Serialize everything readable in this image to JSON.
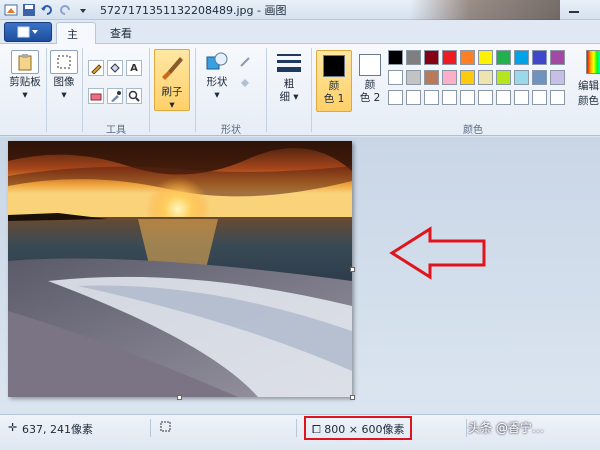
{
  "window": {
    "title": "572717135113220848​9.jpg - 画图"
  },
  "tabs": [
    {
      "label": "主页"
    },
    {
      "label": "查看"
    }
  ],
  "ribbon": {
    "clipboard_label": "剪贴板",
    "image_label": "图像",
    "tools_group_label": "工具",
    "brush_label": "刷子",
    "shapes_label": "形状",
    "shapes_group_label": "形状",
    "size_label_1": "粗",
    "size_label_2": "细",
    "color1_label_1": "颜",
    "color1_label_2": "色 1",
    "color2_label_1": "颜",
    "color2_label_2": "色 2",
    "colors_group_label": "颜色",
    "edit_colors_label": "编辑颜色",
    "color1_value": "#000000",
    "color2_value": "#ffffff",
    "palette_row1": [
      "#000000",
      "#7f7f7f",
      "#880015",
      "#ed1c24",
      "#ff7f27",
      "#fff200",
      "#22b14c",
      "#00a2e8",
      "#3f48cc",
      "#a349a4"
    ],
    "palette_row2": [
      "#ffffff",
      "#c3c3c3",
      "#b97a57",
      "#ffaec9",
      "#ffc90e",
      "#efe4b0",
      "#b5e61d",
      "#99d9ea",
      "#7092be",
      "#c8bfe7"
    ],
    "palette_row3": [
      "#ffffff",
      "#ffffff",
      "#ffffff",
      "#ffffff",
      "#ffffff",
      "#ffffff",
      "#ffffff",
      "#ffffff",
      "#ffffff",
      "#ffffff"
    ]
  },
  "status": {
    "cursor_position": "637, 241像素",
    "image_size": "800 × 600像素",
    "watermark": "头条 @香宁…"
  },
  "colors": {
    "highlight_red": "#e0141c",
    "accent_blue": "#1d4e9f"
  }
}
